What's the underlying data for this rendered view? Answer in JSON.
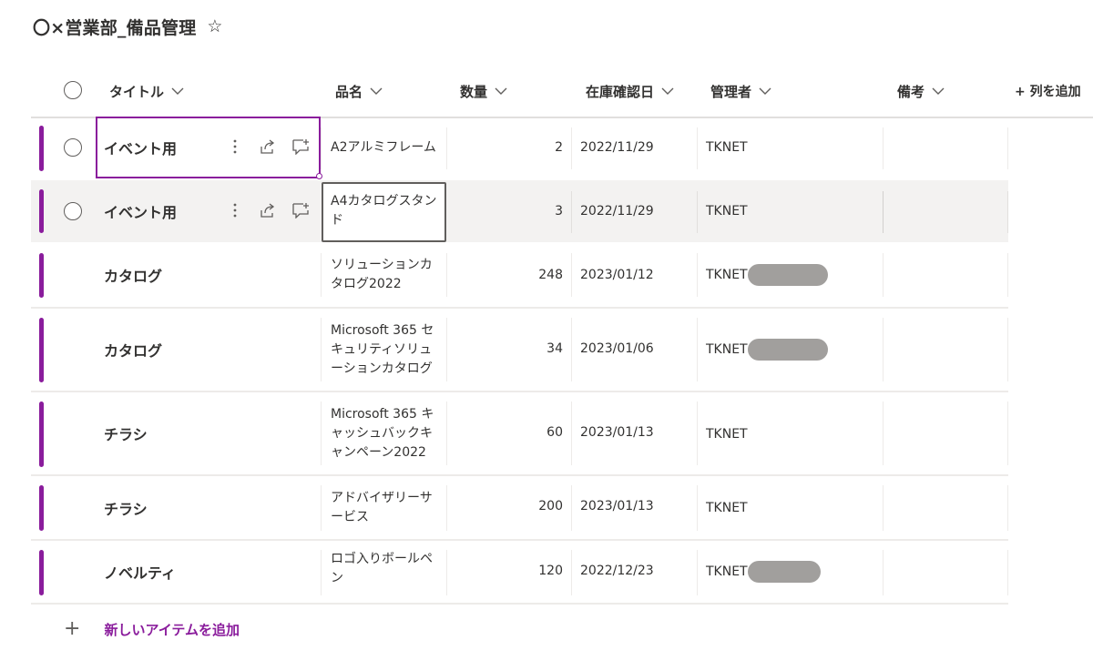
{
  "list": {
    "title": "〇×営業部_備品管理",
    "favorite_icon": "star-outline-icon"
  },
  "columns": {
    "title": "タイトル",
    "item_name": "品名",
    "quantity": "数量",
    "check_date": "在庫確認日",
    "manager": "管理者",
    "notes": "備考",
    "add_column": "+ 列を追加"
  },
  "rows": [
    {
      "title": "イベント用",
      "item_name": "A2アルミフレーム",
      "quantity": "2",
      "check_date": "2022/11/29",
      "manager": "TKNET",
      "notes": ""
    },
    {
      "title": "イベント用",
      "item_name": "A4カタログスタンド",
      "quantity": "3",
      "check_date": "2022/11/29",
      "manager": "TKNET",
      "notes": ""
    },
    {
      "title": "カタログ",
      "item_name": "ソリューションカタログ2022",
      "quantity": "248",
      "check_date": "2023/01/12",
      "manager": "TKNET",
      "notes": ""
    },
    {
      "title": "カタログ",
      "item_name": "Microsoft 365 セキュリティソリューションカタログ",
      "quantity": "34",
      "check_date": "2023/01/06",
      "manager": "TKNET",
      "notes": ""
    },
    {
      "title": "チラシ",
      "item_name": "Microsoft 365 キャッシュバックキャンペーン2022",
      "quantity": "60",
      "check_date": "2023/01/13",
      "manager": "TKNET",
      "notes": ""
    },
    {
      "title": "チラシ",
      "item_name": "アドバイザリーサービス",
      "quantity": "200",
      "check_date": "2023/01/13",
      "manager": "TKNET",
      "notes": ""
    },
    {
      "title": "ノベルティ",
      "item_name": "ロゴ入りボールペン",
      "quantity": "120",
      "check_date": "2022/12/23",
      "manager": "TKNET",
      "notes": ""
    }
  ],
  "footer": {
    "add_item_label": "新しいアイテムを追加"
  },
  "colors": {
    "accent": "#8a1c9c",
    "selected_row_bg": "#f3f2f1",
    "redacted": "#a19f9d"
  }
}
